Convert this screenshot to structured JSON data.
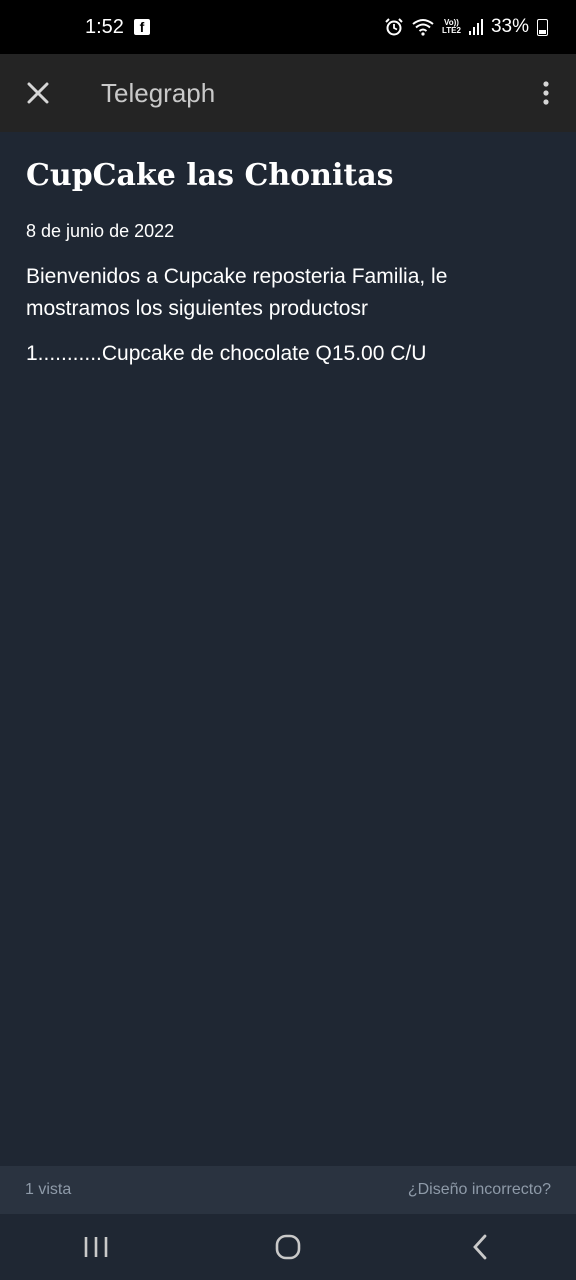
{
  "status_bar": {
    "time": "1:52",
    "notification_icon": "facebook-icon",
    "lte_label_top": "Vo))",
    "lte_label_bottom": "LTE2",
    "battery_percent": "33%"
  },
  "app_bar": {
    "title": "Telegraph",
    "close_icon": "close-icon",
    "menu_icon": "more-vertical-icon"
  },
  "article": {
    "title": "CupCake las Chonitas",
    "date": "8 de junio de 2022",
    "paragraphs": [
      "Bienvenidos a Cupcake reposteria Familia, le mostramos los siguientes productosr",
      "1...........Cupcake de chocolate Q15.00 C/U"
    ]
  },
  "footer": {
    "views": "1 vista",
    "report_link": "¿Diseño incorrecto?"
  },
  "nav_bar": {
    "recents_icon": "recents-icon",
    "home_icon": "home-icon",
    "back_icon": "back-icon"
  },
  "colors": {
    "background": "#1f2733",
    "app_bar": "#242424",
    "footer": "#2a3340",
    "muted_text": "#8e9aa8"
  }
}
